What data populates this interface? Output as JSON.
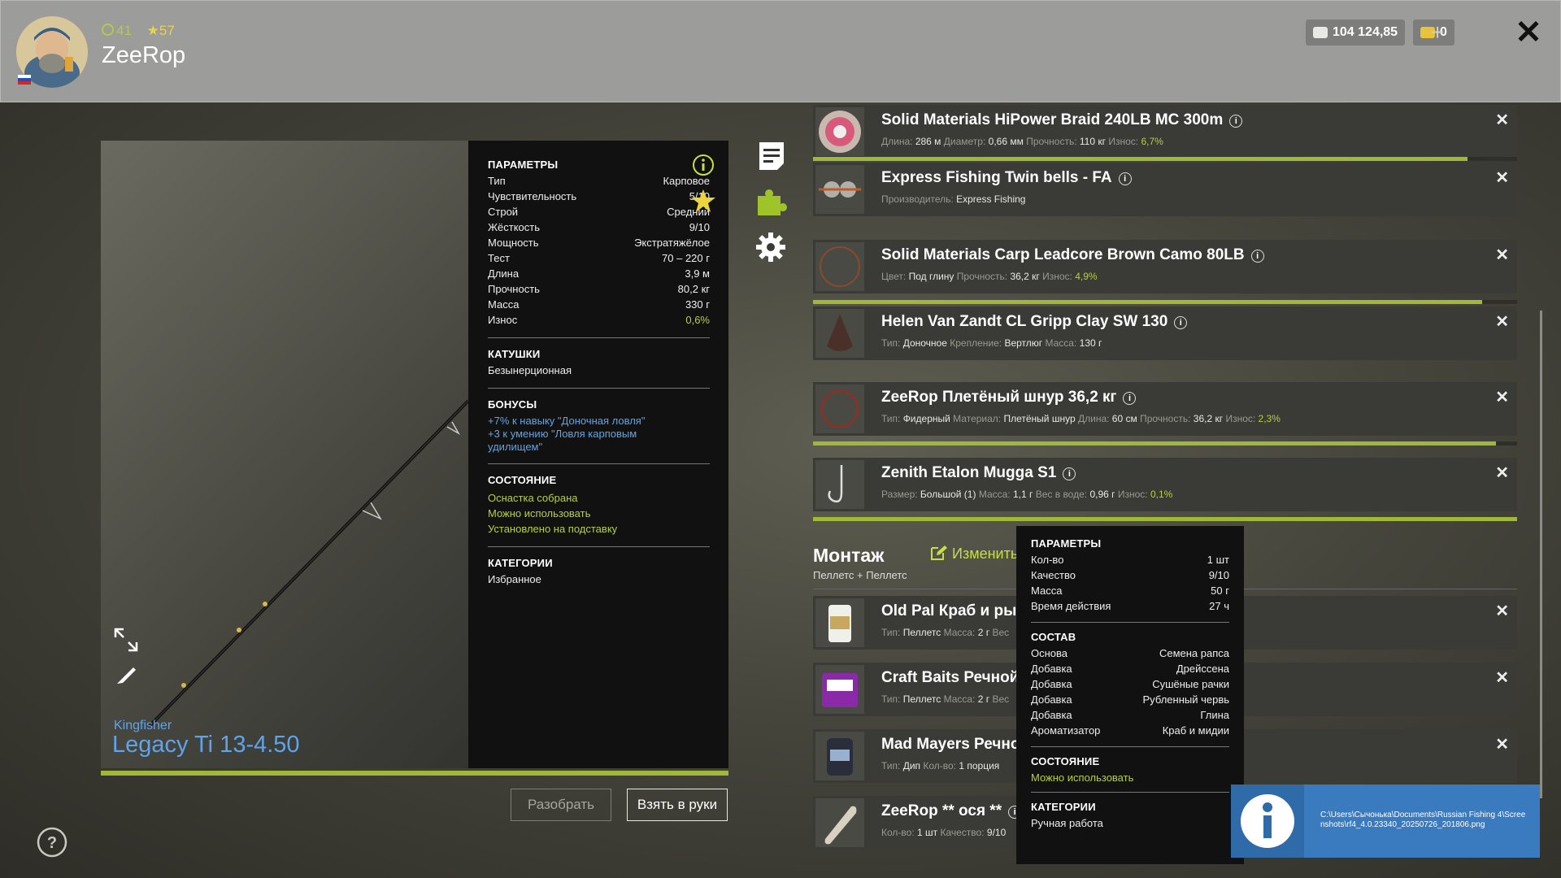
{
  "player": {
    "rank": "41",
    "stars": "57",
    "name": "ZeeRop"
  },
  "currency": {
    "silver": "104 124,85",
    "gold": "0"
  },
  "rod": {
    "brand": "Kingfisher",
    "model": "Legacy Ti 13-4.50"
  },
  "params": {
    "title": "ПАРАМЕТРЫ",
    "rows": [
      {
        "k": "Тип",
        "v": "Карповое"
      },
      {
        "k": "Чувствительность",
        "v": "5/10"
      },
      {
        "k": "Строй",
        "v": "Средний"
      },
      {
        "k": "Жёсткость",
        "v": "9/10"
      },
      {
        "k": "Мощность",
        "v": "Экстратяжёлое"
      },
      {
        "k": "Тест",
        "v": "70 – 220 г"
      },
      {
        "k": "Длина",
        "v": "3,9 м"
      },
      {
        "k": "Прочность",
        "v": "80,2 кг"
      },
      {
        "k": "Масса",
        "v": "330 г"
      },
      {
        "k": "Износ",
        "v": "0,6%"
      }
    ],
    "reels_title": "КАТУШКИ",
    "reels_value": "Безынерционная",
    "bonus_title": "БОНУСЫ",
    "bonus_1": "+7% к навыку \"Доночная ловля\"",
    "bonus_2": "+3 к умению \"Ловля карповым удилищем\"",
    "state_title": "СОСТОЯНИЕ",
    "state_1": "Оснастка собрана",
    "state_2": "Можно использовать",
    "state_3": "Установлено на подставку",
    "cat_title": "КАТЕГОРИИ",
    "cat_value": "Избранное"
  },
  "buttons": {
    "disassemble": "Разобрать",
    "take": "Взять в руки"
  },
  "items": [
    {
      "name": "Solid Materials HiPower Braid 240LB MC 300m",
      "details": [
        [
          "Длина:",
          "286 м"
        ],
        [
          "Диаметр:",
          "0,66 мм"
        ],
        [
          "Прочность:",
          "110 кг"
        ],
        [
          "Износ:",
          "6,7%"
        ]
      ],
      "wear": 0.93
    },
    {
      "name": "Express Fishing Twin bells - FA",
      "details": [
        [
          "Производитель:",
          "Express Fishing"
        ]
      ]
    },
    {
      "name": "Solid Materials Carp Leadcore Brown Camo 80LB",
      "details": [
        [
          "Цвет:",
          "Под глину"
        ],
        [
          "Прочность:",
          "36,2 кг"
        ],
        [
          "Износ:",
          "4,9%"
        ]
      ],
      "wear": 0.95
    },
    {
      "name": "Helen Van Zandt CL Gripp Clay SW 130",
      "details": [
        [
          "Тип:",
          "Доночное"
        ],
        [
          "Крепление:",
          "Вертлюг"
        ],
        [
          "Масса:",
          "130 г"
        ]
      ]
    },
    {
      "name": "ZeeRop Плетёный шнур 36,2 кг",
      "details": [
        [
          "Тип:",
          "Фидерный"
        ],
        [
          "Материал:",
          "Плетёный шнур"
        ],
        [
          "Длина:",
          "60 см"
        ],
        [
          "Прочность:",
          "36,2 кг"
        ],
        [
          "Износ:",
          "2,3%"
        ]
      ],
      "wear": 0.97
    },
    {
      "name": "Zenith Etalon Mugga S1",
      "details": [
        [
          "Размер:",
          "Большой (1)"
        ],
        [
          "Масса:",
          "1,1 г"
        ],
        [
          "Вес в воде:",
          "0,96 г"
        ],
        [
          "Износ:",
          "0,1%"
        ]
      ],
      "wear": 1.0
    }
  ],
  "montage": {
    "title": "Монтаж",
    "subtitle": "Пеллетс + Пеллетс",
    "edit_label": "Изменить"
  },
  "montage_items": [
    {
      "name": "Old Pal Краб и рыб",
      "details": [
        [
          "Тип:",
          "Пеллетс"
        ],
        [
          "Масса:",
          "2 г"
        ],
        [
          "Вес",
          ""
        ]
      ]
    },
    {
      "name": "Craft Baits Речной р",
      "details": [
        [
          "Тип:",
          "Пеллетс"
        ],
        [
          "Масса:",
          "2 г"
        ],
        [
          "Вес",
          ""
        ]
      ]
    },
    {
      "name": "Mad Mayers Речно",
      "details": [
        [
          "Тип:",
          "Дип"
        ],
        [
          "Кол-во:",
          "1 порция"
        ]
      ]
    },
    {
      "name": "ZeeRop ** ося **",
      "details": [
        [
          "Кол-во:",
          "1 шт"
        ],
        [
          "Качество:",
          "9/10"
        ]
      ]
    }
  ],
  "tooltip": {
    "params_title": "ПАРАМЕТРЫ",
    "params": [
      {
        "k": "Кол-во",
        "v": "1 шт"
      },
      {
        "k": "Качество",
        "v": "9/10"
      },
      {
        "k": "Масса",
        "v": "50 г"
      },
      {
        "k": "Время действия",
        "v": "27 ч"
      }
    ],
    "comp_title": "СОСТАВ",
    "comp": [
      {
        "k": "Основа",
        "v": "Семена рапса"
      },
      {
        "k": "Добавка",
        "v": "Дрейссена"
      },
      {
        "k": "Добавка",
        "v": "Сушёные рачки"
      },
      {
        "k": "Добавка",
        "v": "Рубленный червь"
      },
      {
        "k": "Добавка",
        "v": "Глина"
      },
      {
        "k": "Ароматизатор",
        "v": "Краб и мидии"
      }
    ],
    "state_title": "СОСТОЯНИЕ",
    "state_value": "Можно использовать",
    "cat_title": "КАТЕГОРИИ",
    "cat_value": "Ручная работа"
  },
  "notification": {
    "path": "C:\\Users\\Сычонька\\Documents\\Russian Fishing 4\\Screenshots\\rf4_4.0.23340_20250726_201806.png"
  },
  "colors": {
    "accent_green": "#b8cf3c",
    "link_blue": "#5fa4e8",
    "notify_blue": "#3a7abf"
  }
}
